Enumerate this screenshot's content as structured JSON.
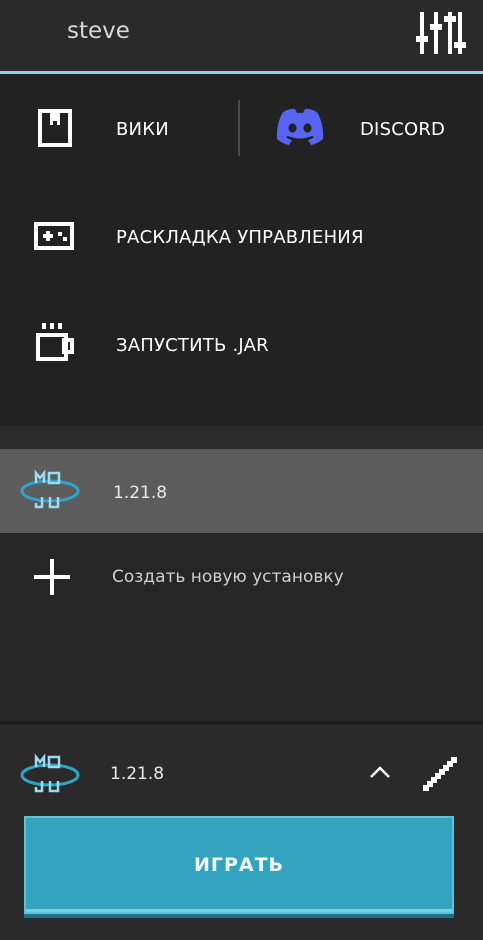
{
  "header": {
    "account_name": "steve"
  },
  "menu": {
    "wiki_label": "ВИКИ",
    "discord_label": "DISCORD",
    "controls_label": "РАСКЛАДКА УПРАВЛЕНИЯ",
    "jar_label": "ЗАПУСТИТЬ .JAR"
  },
  "installations": {
    "items": [
      {
        "version": "1.21.8"
      }
    ],
    "create_label": "Создать новую установку"
  },
  "bottom": {
    "selected_version": "1.21.8",
    "play_label": "ИГРАТЬ"
  },
  "colors": {
    "accent": "#8fd2e6",
    "play_button": "#33a3bf",
    "discord": "#5865f2",
    "selected_row": "#5c5c5c"
  }
}
